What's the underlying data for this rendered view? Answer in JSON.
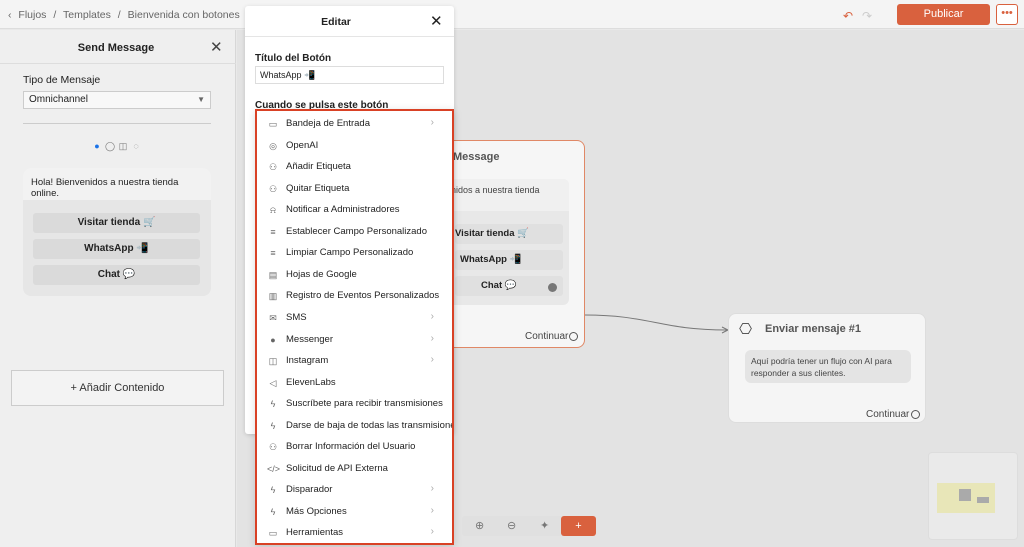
{
  "breadcrumb": {
    "items": [
      "Flujos",
      "Templates",
      "Bienvenida con botones"
    ],
    "sep": "/"
  },
  "topbar": {
    "publish_label": "Publicar",
    "more_label": "•••"
  },
  "left_panel": {
    "title": "Send Message",
    "type_label": "Tipo de Mensaje",
    "type_value": "Omnichannel",
    "message_text": "Hola! Bienvenidos a nuestra tienda online.",
    "buttons": [
      "Visitar tienda 🛒",
      "WhatsApp 📲",
      "Chat 💬"
    ],
    "add_content_label": "Añadir Contenido"
  },
  "dialog": {
    "title": "Editar",
    "field_label": "Título del Botón",
    "field_value": "WhatsApp 📲",
    "when_label": "Cuando se pulsa este botón"
  },
  "menu": {
    "items": [
      {
        "label": "Bandeja de Entrada",
        "icon": "inbox-icon",
        "glyph": "▭",
        "chevron": true
      },
      {
        "label": "OpenAI",
        "icon": "openai-icon",
        "glyph": "◎",
        "chevron": false
      },
      {
        "label": "Añadir Etiqueta",
        "icon": "add-tag-icon",
        "glyph": "⚇",
        "chevron": false
      },
      {
        "label": "Quitar Etiqueta",
        "icon": "remove-tag-icon",
        "glyph": "⚇",
        "chevron": false
      },
      {
        "label": "Notificar a Administradores",
        "icon": "bell-icon",
        "glyph": "⍾",
        "chevron": false
      },
      {
        "label": "Establecer Campo Personalizado",
        "icon": "database-icon",
        "glyph": "≡",
        "chevron": false
      },
      {
        "label": "Limpiar Campo Personalizado",
        "icon": "database-icon",
        "glyph": "≡",
        "chevron": false
      },
      {
        "label": "Hojas de Google",
        "icon": "sheet-icon",
        "glyph": "▤",
        "chevron": false
      },
      {
        "label": "Registro de Eventos Personalizados",
        "icon": "analytics-icon",
        "glyph": "▥",
        "chevron": false
      },
      {
        "label": "SMS",
        "icon": "sms-icon",
        "glyph": "✉",
        "chevron": true
      },
      {
        "label": "Messenger",
        "icon": "messenger-icon",
        "glyph": "●",
        "chevron": true
      },
      {
        "label": "Instagram",
        "icon": "instagram-icon",
        "glyph": "◫",
        "chevron": true
      },
      {
        "label": "ElevenLabs",
        "icon": "speaker-icon",
        "glyph": "◁",
        "chevron": false
      },
      {
        "label": "Suscríbete para recibir transmisiones",
        "icon": "bolt-icon",
        "glyph": "ϟ",
        "chevron": false
      },
      {
        "label": "Darse de baja de todas las transmisiones",
        "icon": "bolt-icon",
        "glyph": "ϟ",
        "chevron": false
      },
      {
        "label": "Borrar Información del Usuario",
        "icon": "user-remove-icon",
        "glyph": "⚇",
        "chevron": false
      },
      {
        "label": "Solicitud de API Externa",
        "icon": "code-icon",
        "glyph": "</>",
        "chevron": false
      },
      {
        "label": "Disparador",
        "icon": "trigger-icon",
        "glyph": "ϟ",
        "chevron": true
      },
      {
        "label": "Más Opciones",
        "icon": "bolt-icon",
        "glyph": "ϟ",
        "chevron": true
      },
      {
        "label": "Herramientas",
        "icon": "toolbox-icon",
        "glyph": "▭",
        "chevron": true
      }
    ]
  },
  "node1": {
    "title": "Message",
    "text": "nidos a nuestra tienda",
    "buttons": [
      "Visitar tienda 🛒",
      "WhatsApp 📲",
      "Chat 💬"
    ],
    "continue_label": "Continuar"
  },
  "node2": {
    "title": "Enviar mensaje #1",
    "text": "Aquí podría tener un flujo con AI para responder a sus clientes.",
    "continue_label": "Continuar"
  },
  "colors": {
    "accent": "#d9613e",
    "menu_border": "#d94125"
  }
}
